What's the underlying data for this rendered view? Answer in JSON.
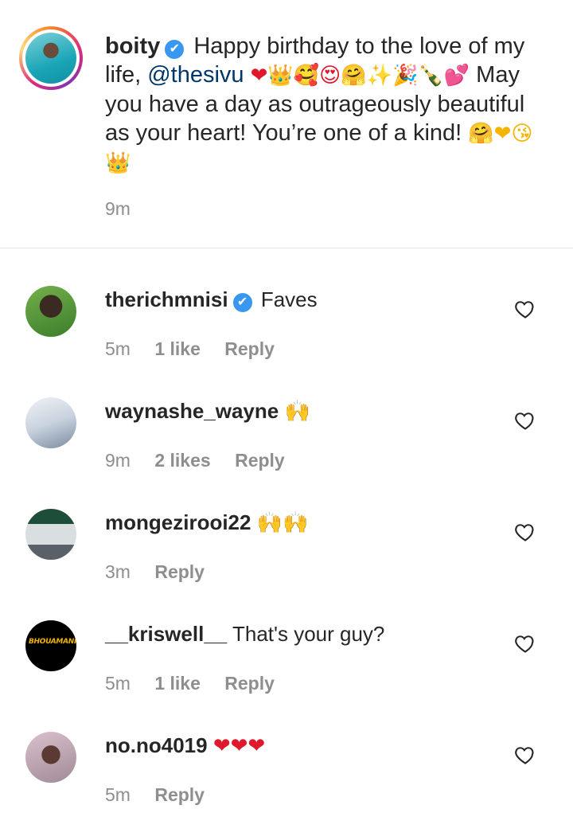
{
  "caption": {
    "username": "boity",
    "verified_mark": "✔",
    "text_before_mention": "Happy birthday to the love of my life,",
    "mention": "@thesivu",
    "emojis_line1": "❤👑🥰😍🤗✨🎉🍾💕",
    "text_after": "May you have a day as outrageously beautiful as your heart! You’re one of a kind!",
    "emojis_line2": "🤗❤😘👑",
    "time": "9m"
  },
  "comments": [
    {
      "username": "therichmnisi",
      "verified": true,
      "text": "Faves",
      "time": "5m",
      "likes": "1 like",
      "reply": "Reply",
      "avatar_icon": "profile-photo"
    },
    {
      "username": "waynashe_wayne",
      "verified": false,
      "text": "🙌",
      "time": "9m",
      "likes": "2 likes",
      "reply": "Reply",
      "avatar_icon": "profile-photo"
    },
    {
      "username": "mongezirooi22",
      "verified": false,
      "text": "🙌🙌",
      "time": "3m",
      "likes": "",
      "reply": "Reply",
      "avatar_icon": "profile-photo"
    },
    {
      "username": "__kriswell__",
      "verified": false,
      "text": "That's your guy?",
      "time": "5m",
      "likes": "1 like",
      "reply": "Reply",
      "avatar_icon": "profile-logo",
      "avatar_logo_text": "BHOUAMANIA"
    },
    {
      "username": "no.no4019",
      "verified": false,
      "text": "❤❤❤",
      "time": "5m",
      "likes": "",
      "reply": "Reply",
      "avatar_icon": "profile-photo"
    }
  ],
  "colors": {
    "text": "#262626",
    "secondary": "#8e8e8e",
    "mention": "#00376b",
    "verified": "#3897f0",
    "heart": "#e0182d"
  }
}
